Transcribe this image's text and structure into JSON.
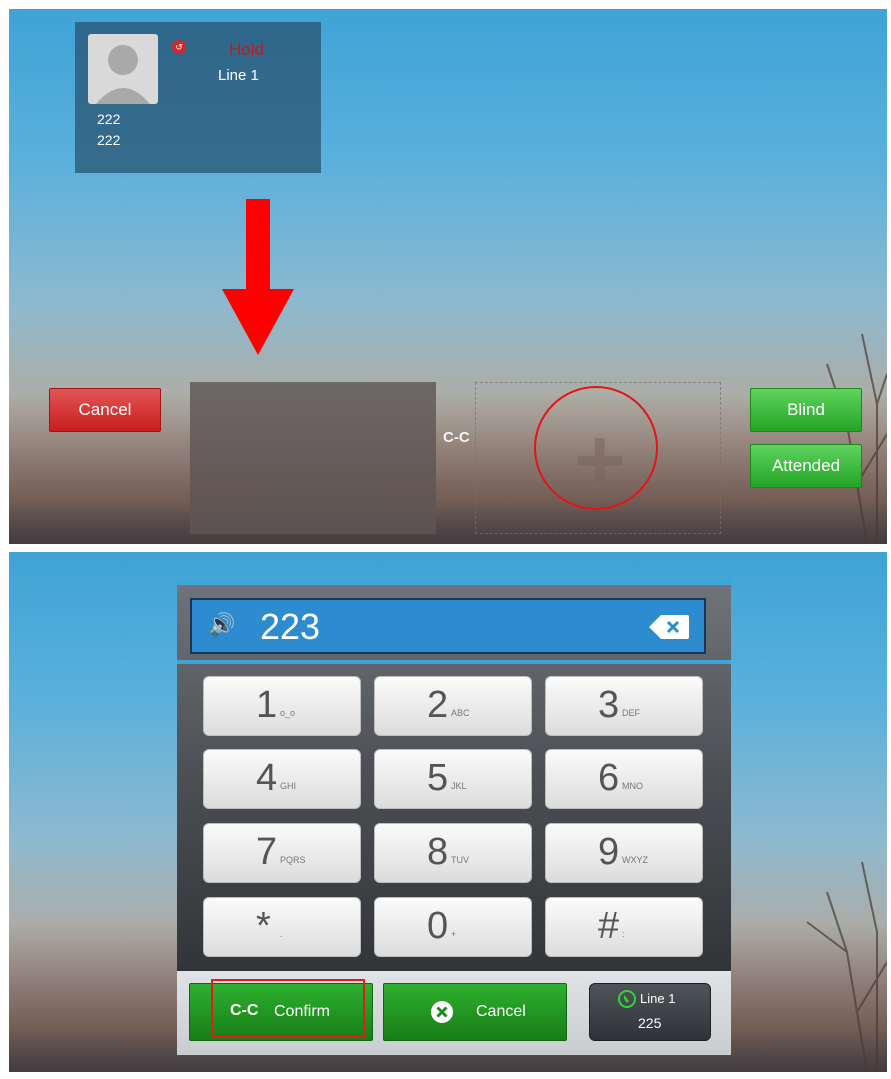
{
  "top_panel": {
    "contact": {
      "status": "Hold",
      "line": "Line 1",
      "name": "222",
      "number": "222"
    },
    "cancel_button": "Cancel",
    "blind_button": "Blind",
    "attended_button": "Attended",
    "transfer_icon": "C-C",
    "drop_target_icon": "plus-icon",
    "annotation": {
      "arrow_color": "#ff0000",
      "circle_color": "#e31515"
    }
  },
  "dialer": {
    "display_number": "223",
    "keys": [
      {
        "digit": "1",
        "letters": "o_o"
      },
      {
        "digit": "2",
        "letters": "ABC"
      },
      {
        "digit": "3",
        "letters": "DEF"
      },
      {
        "digit": "4",
        "letters": "GHI"
      },
      {
        "digit": "5",
        "letters": "JKL"
      },
      {
        "digit": "6",
        "letters": "MNO"
      },
      {
        "digit": "7",
        "letters": "PQRS"
      },
      {
        "digit": "8",
        "letters": "TUV"
      },
      {
        "digit": "9",
        "letters": "WXYZ"
      },
      {
        "digit": "*",
        "letters": "."
      },
      {
        "digit": "0",
        "letters": "+"
      },
      {
        "digit": "#",
        "letters": ":"
      }
    ],
    "footer": {
      "confirm_label": "Confirm",
      "confirm_icon": "C-C",
      "cancel_label": "Cancel",
      "line_label": "Line 1",
      "line_number": "225"
    }
  },
  "colors": {
    "accent_blue": "#3fa4d8",
    "hold_red": "#c11b1b",
    "button_green": "#24a424",
    "button_red": "#c91d1d"
  }
}
